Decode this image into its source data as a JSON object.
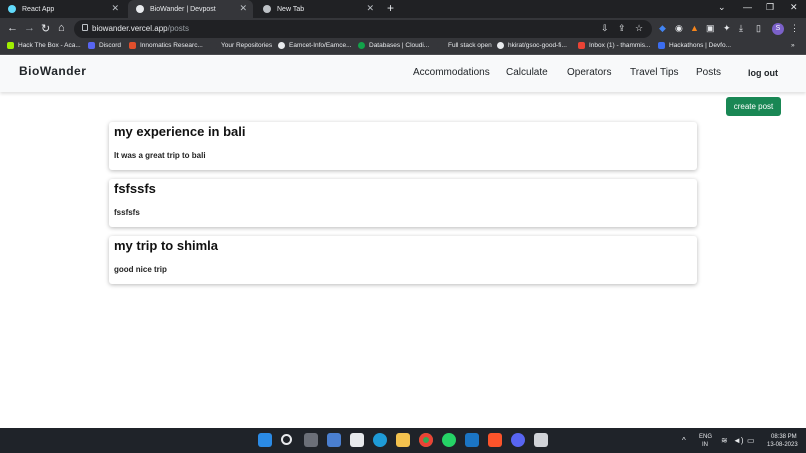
{
  "browser": {
    "tabs": [
      {
        "label": "React App",
        "favicon_color": "#61dafb",
        "active": false
      },
      {
        "label": "BioWander | Devpost",
        "favicon_color": "#e8eaed",
        "active": true
      },
      {
        "label": "New Tab",
        "favicon_color": "#bdc1c6",
        "active": false
      }
    ],
    "new_tab_symbol": "+",
    "url_host": "biowander.vercel.app",
    "url_path": "/posts",
    "profile_initial": "S",
    "bookmarks": [
      {
        "label": "Hack The Box - Aca...",
        "color": "#9fef00"
      },
      {
        "label": "Discord",
        "color": "#5865f2"
      },
      {
        "label": "Innomatics Researc...",
        "color": "#e04f2c"
      },
      {
        "label": "Your Repositories",
        "color": "#35363a"
      },
      {
        "label": "Eamcet-Info/Eamce...",
        "color": "#e8eaed"
      },
      {
        "label": "Databases | Cloudi...",
        "color": "#12a34a"
      },
      {
        "label": "Full stack open",
        "color": "#35363a"
      },
      {
        "label": "hkirat/gsoc-good-fi...",
        "color": "#e8eaed"
      },
      {
        "label": "Inbox (1) - thammis...",
        "color": "#ea4335"
      },
      {
        "label": "Hackathons | Devfo...",
        "color": "#3b6df0"
      }
    ]
  },
  "app": {
    "brand": "BioWander",
    "nav_links": [
      "Accommodations",
      "Calculate",
      "Operators",
      "Travel Tips",
      "Posts"
    ],
    "logout_label": "log out",
    "create_post_label": "create post",
    "posts": [
      {
        "title": "my experience in bali",
        "body": "It was a great trip to bali"
      },
      {
        "title": "fsfssfs",
        "body": "fssfsfs"
      },
      {
        "title": "my trip to shimla",
        "body": "good nice trip"
      }
    ]
  },
  "taskbar": {
    "language": "ENG",
    "region": "IN",
    "time": "08:38 PM",
    "date": "13-08-2023"
  }
}
